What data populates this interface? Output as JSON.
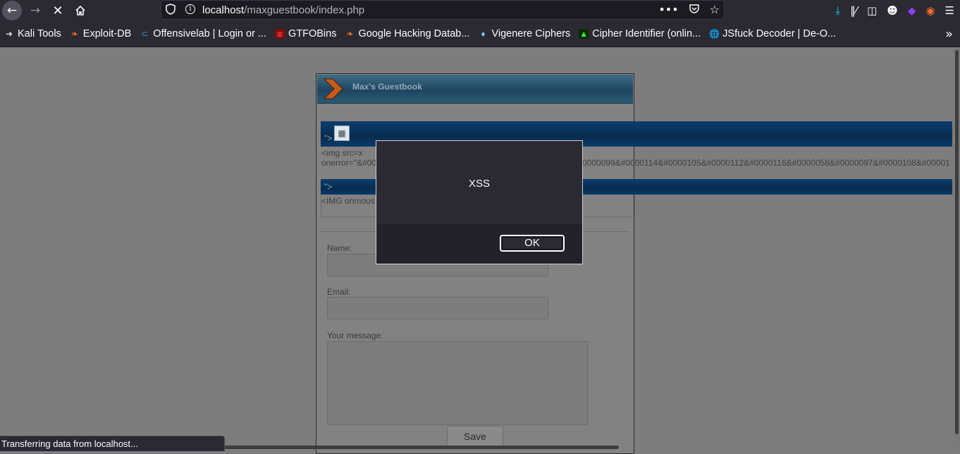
{
  "browser": {
    "url_host": "localhost",
    "url_path": "/maxguestbook/index.php",
    "bookmarks": [
      {
        "label": "Kali Tools",
        "icon": "kali-dragon-icon"
      },
      {
        "label": "Exploit-DB",
        "icon": "exploit-db-icon"
      },
      {
        "label": "Offensivelab | Login or ...",
        "icon": "offensivelab-icon"
      },
      {
        "label": "GTFOBins",
        "icon": "gtfobins-icon"
      },
      {
        "label": "Google Hacking Datab...",
        "icon": "exploit-db-icon"
      },
      {
        "label": "Vigenere Ciphers",
        "icon": "diamond-icon"
      },
      {
        "label": "Cipher Identifier (onlin...",
        "icon": "dcode-icon"
      },
      {
        "label": "JSfuck Decoder | De-O...",
        "icon": "globe-icon"
      }
    ],
    "status_text": "Transferring data from localhost..."
  },
  "guestbook": {
    "title": "Max's Guestbook",
    "entries": [
      {
        "name": "\">",
        "message_line1": "<img src=x",
        "message_line2": "onerror=\"&#00",
        "message_overflow": "0000099&#0000114&#0000105&#0000112&#0000116&#0000058&#0000097&#0000108&#00001"
      },
      {
        "name": "\">",
        "message_line1": "<IMG onmous"
      }
    ],
    "form": {
      "name_label": "Name:",
      "email_label": "Email:",
      "message_label": "Your message:",
      "save_label": "Save"
    }
  },
  "dialog": {
    "message": "XSS",
    "ok_label": "OK"
  }
}
